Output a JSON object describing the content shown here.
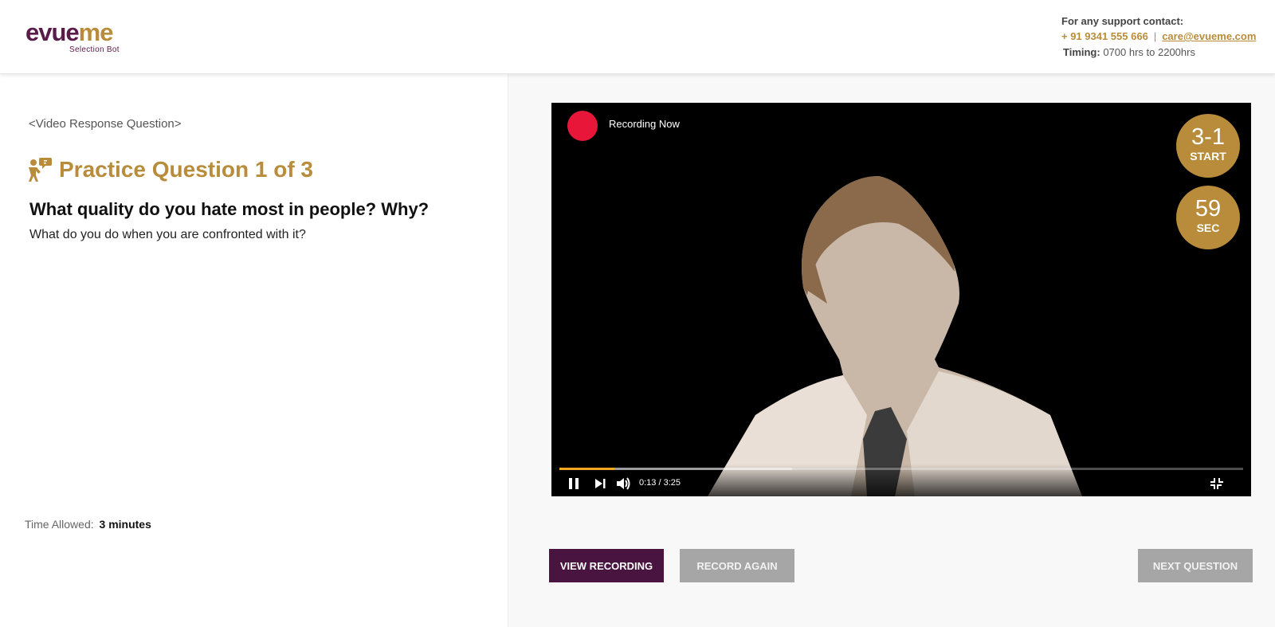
{
  "brand": {
    "logo_part1": "ev",
    "logo_part2": "ue",
    "logo_part3": "me",
    "tagline": "Selection Bot",
    "colors": {
      "purple": "#5a1a4a",
      "gold": "#b88c3a"
    }
  },
  "support": {
    "title": "For any support contact:",
    "phone": "+ 91 9341 555 666",
    "separator": "|",
    "email": "care@evueme.com",
    "timing_label": "Timing:",
    "timing_value": "0700 hrs to  2200hrs"
  },
  "question": {
    "type_label": "<Video Response Question>",
    "practice_title": "Practice Question 1 of 3",
    "main_text": "What quality do you hate most in people? Why?",
    "sub_text": "What do you do when you are confronted with it?",
    "time_allowed_label": "Time Allowed:",
    "time_allowed_value": "3 minutes"
  },
  "video": {
    "recording_label": "Recording Now",
    "start_badge": {
      "value": "3-1",
      "label": "START"
    },
    "seconds_badge": {
      "value": "59",
      "label": "SEC"
    },
    "time_readout": "0:13 / 3:25",
    "played_fraction": 0.08,
    "buffered_fraction": 0.34,
    "accent_color": "#f6a623",
    "recording_color": "#e8173a"
  },
  "actions": {
    "view_recording": "VIEW RECORDING",
    "record_again": "RECORD AGAIN",
    "next_question": "NEXT QUESTION"
  }
}
